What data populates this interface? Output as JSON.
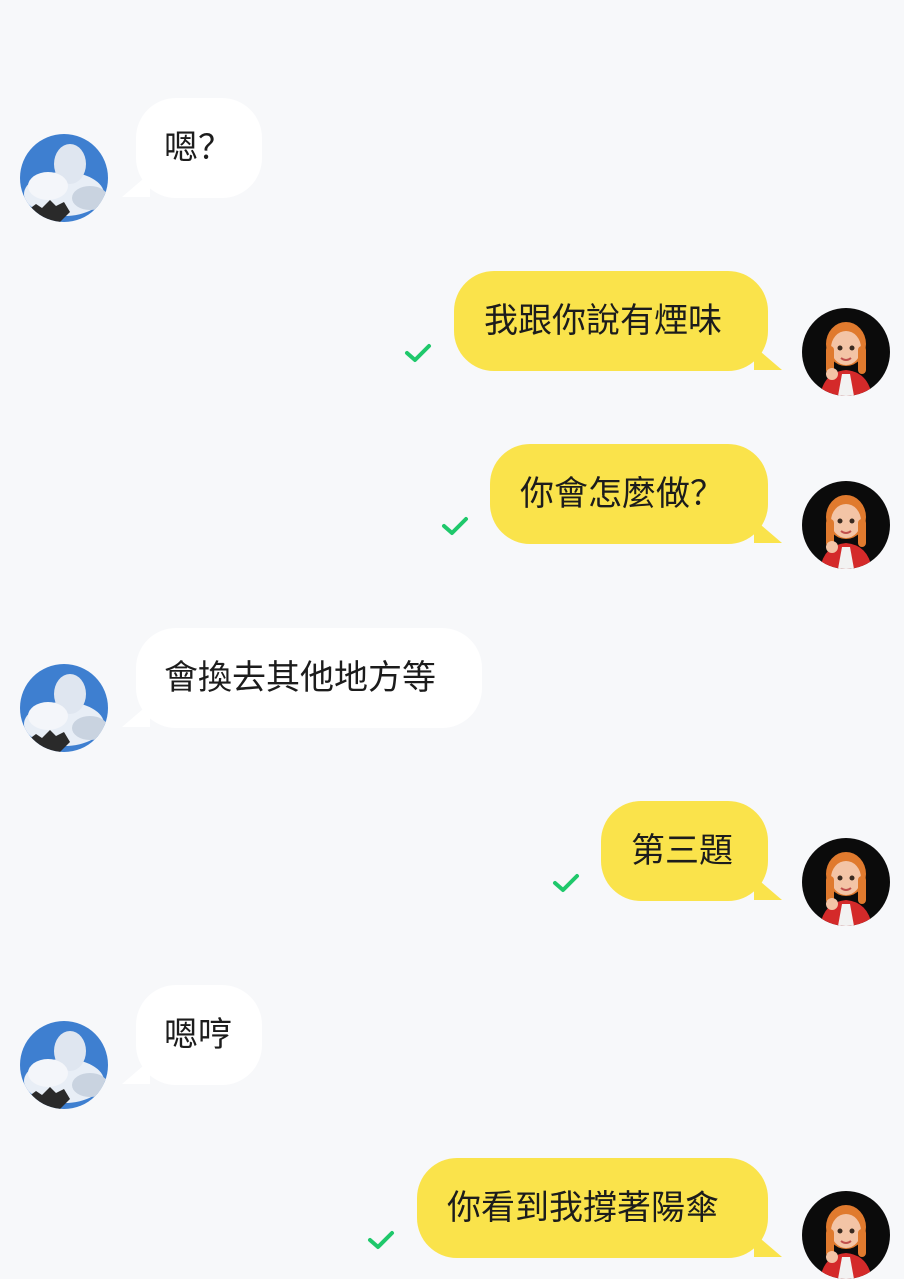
{
  "colors": {
    "background": "#f7f8fa",
    "incoming_bubble": "#ffffff",
    "outgoing_bubble": "#fae34b",
    "read_check": "#1fc86b"
  },
  "icons": {
    "contact_avatar": "cloud-sky-photo-avatar",
    "self_avatar": "memoji-red-hair-avatar",
    "read_receipt": "check-icon"
  },
  "messages": [
    {
      "direction": "in",
      "text": "嗯？"
    },
    {
      "direction": "out",
      "text": "我跟你說有煙味",
      "read": true
    },
    {
      "direction": "out",
      "text": "你會怎麼做？",
      "read": true
    },
    {
      "direction": "in",
      "text": "會換去其他地方等"
    },
    {
      "direction": "out",
      "text": "第三題",
      "read": true
    },
    {
      "direction": "in",
      "text": "嗯哼"
    },
    {
      "direction": "out",
      "text": "你看到我撐著陽傘",
      "read": true
    }
  ]
}
